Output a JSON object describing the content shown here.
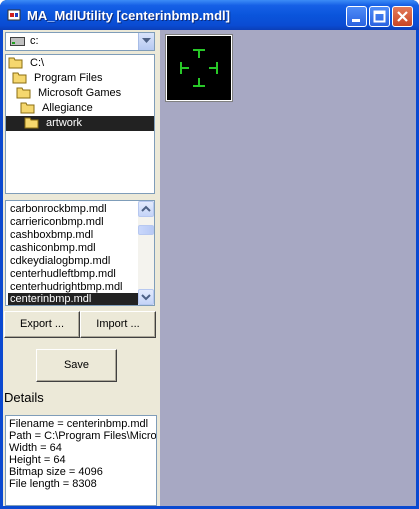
{
  "window": {
    "title": "MA_MdlUtility [centerinbmp.mdl]"
  },
  "drive": {
    "value": "c:"
  },
  "directories": [
    {
      "label": "C:\\",
      "level": 0,
      "selected": false
    },
    {
      "label": "Program Files",
      "level": 1,
      "selected": false
    },
    {
      "label": "Microsoft Games",
      "level": 2,
      "selected": false
    },
    {
      "label": "Allegiance",
      "level": 3,
      "selected": false
    },
    {
      "label": "artwork",
      "level": 4,
      "selected": true
    }
  ],
  "files": [
    {
      "label": "carbonrockbmp.mdl",
      "selected": false
    },
    {
      "label": "carriericonbmp.mdl",
      "selected": false
    },
    {
      "label": "cashboxbmp.mdl",
      "selected": false
    },
    {
      "label": "cashiconbmp.mdl",
      "selected": false
    },
    {
      "label": "cdkeydialogbmp.mdl",
      "selected": false
    },
    {
      "label": "centerhudleftbmp.mdl",
      "selected": false
    },
    {
      "label": "centerhudrightbmp.mdl",
      "selected": false
    },
    {
      "label": "centerinbmp.mdl",
      "selected": true
    }
  ],
  "buttons": {
    "export_label": "Export ...",
    "import_label": "Import ...",
    "save_label": "Save"
  },
  "details": {
    "heading": "Details",
    "lines": [
      "Filename = centerinbmp.mdl",
      "Path = C:\\Program Files\\Micros",
      "Width = 64",
      "Height = 64",
      "Bitmap size = 4096",
      "File length = 8308"
    ]
  },
  "colors": {
    "canvas_background": "#a7a8c3",
    "preview_glyph": "#28c828",
    "selection": "#222222"
  }
}
